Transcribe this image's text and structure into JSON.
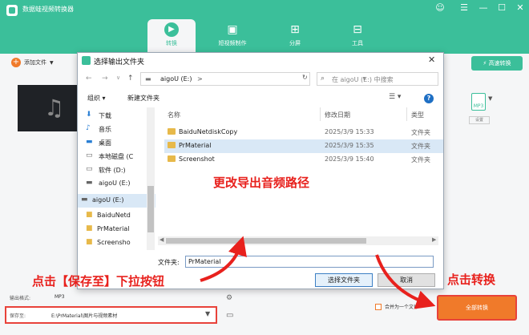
{
  "app": {
    "title": "数据蛙视频转换器",
    "window_controls": [
      "☺",
      "☰",
      "—",
      "☐",
      "✕"
    ],
    "tabs": [
      {
        "label": "转换",
        "icon": "convert-icon",
        "active": true
      },
      {
        "label": "短视频制作",
        "icon": "film-icon"
      },
      {
        "label": "分屏",
        "icon": "split-screen-icon"
      },
      {
        "label": "工具",
        "icon": "toolbox-icon"
      }
    ],
    "add_file": "添加文件",
    "speed_convert": "高速转换",
    "format_icon_text": "MP3",
    "settings_label": "设置",
    "output_format_label": "输出格式:",
    "output_format_value": "MP3",
    "save_to_label": "保存至:",
    "save_to_path": "E:\\PrMaterial\\图片与视频素材",
    "merge_label": "合并为一个文件",
    "convert_all": "全部转换"
  },
  "dialog": {
    "title": "选择输出文件夹",
    "address_drive": "aigoU (E:)",
    "address_separator": ">",
    "search_placeholder": "在 aigoU (E:) 中搜索",
    "organize": "组织 ▾",
    "new_folder": "新建文件夹",
    "tree": [
      {
        "label": "下载",
        "icon": "download-icon"
      },
      {
        "label": "音乐",
        "icon": "music-icon"
      },
      {
        "label": "桌面",
        "icon": "desktop-icon"
      },
      {
        "label": "本地磁盘 (C",
        "icon": "drive-icon"
      },
      {
        "label": "软件 (D:)",
        "icon": "drive-icon"
      },
      {
        "label": "aigoU (E:)",
        "icon": "usb-drive-icon"
      },
      {
        "label": "aigoU (E:)",
        "icon": "usb-drive-icon",
        "selected": true
      },
      {
        "label": "BaiduNetd",
        "icon": "folder-icon"
      },
      {
        "label": "PrMaterial",
        "icon": "folder-icon"
      },
      {
        "label": "Screensho",
        "icon": "folder-icon"
      }
    ],
    "columns": {
      "name": "名称",
      "date": "修改日期",
      "type": "类型"
    },
    "files": [
      {
        "name": "BaiduNetdiskCopy",
        "date": "2025/3/9 15:33",
        "type": "文件夹"
      },
      {
        "name": "PrMaterial",
        "date": "2025/3/9 15:35",
        "type": "文件夹",
        "selected": true
      },
      {
        "name": "Screenshot",
        "date": "2025/3/9 15:40",
        "type": "文件夹"
      }
    ],
    "folder_label": "文件夹:",
    "folder_value": "PrMaterial",
    "select_button": "选择文件夹",
    "cancel_button": "取消"
  },
  "annotations": {
    "change_path": "更改导出音频路径",
    "click_dropdown": "点击【保存至】下拉按钮",
    "click_convert": "点击转换"
  },
  "colors": {
    "brand": "#3bbf9a",
    "accent": "#f07a2a",
    "annotation": "#e8211d"
  }
}
